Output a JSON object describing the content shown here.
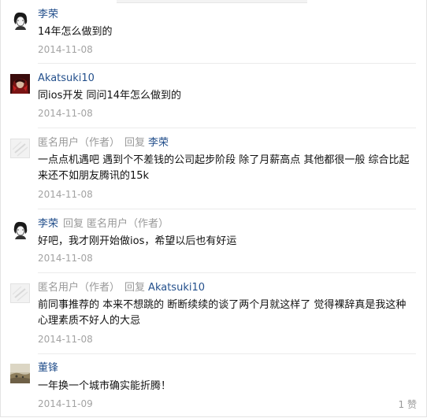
{
  "comments": [
    {
      "author": "李荣",
      "text": "14年怎么做到的",
      "date": "2014-11-08",
      "avatar": "sketch-portrait-avatar"
    },
    {
      "author": "Akatsuki10",
      "text": "同ios开发 同问14年怎么做到的",
      "date": "2014-11-08",
      "avatar": "red-anime-avatar"
    },
    {
      "author": "匿名用户",
      "author_role": "（作者）",
      "reply_word": "回复",
      "reply_to": "李荣",
      "text": "一点点机遇吧 遇到个不差钱的公司起步阶段 除了月薪高点 其他都很一般 综合比起来还不如朋友腾讯的15k",
      "date": "2014-11-08",
      "avatar": "default-user-avatar"
    },
    {
      "author": "李荣",
      "reply_word": "回复",
      "reply_to": "匿名用户",
      "reply_to_role": "（作者）",
      "text": "好吧，我才刚开始做ios，希望以后也有好运",
      "date": "2014-11-08",
      "avatar": "sketch-portrait-avatar"
    },
    {
      "author": "匿名用户",
      "author_role": "（作者）",
      "reply_word": "回复",
      "reply_to": "Akatsuki10",
      "text": "前同事推荐的 本来不想跳的 断断续续的谈了两个月就这样了 觉得裸辞真是我这种心理素质不好人的大忌",
      "date": "2014-11-08",
      "avatar": "default-user-avatar"
    },
    {
      "author": "董锋",
      "text": "一年换一个城市确实能折腾！",
      "date": "2014-11-09",
      "likes": "1 赞",
      "avatar": "landscape-photo-avatar"
    }
  ]
}
